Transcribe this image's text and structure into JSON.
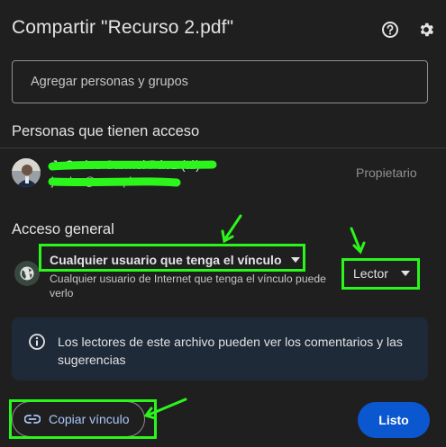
{
  "dialog": {
    "title": "Compartir \"Recurso 2.pdf\"",
    "help_icon": "help-circle-icon",
    "settings_icon": "gear-icon"
  },
  "add_people": {
    "placeholder": "Agregar personas y grupos"
  },
  "people_section": {
    "title": "Personas que tienen acceso",
    "person": {
      "name": "J. Carlos Carmel Páez (tú)",
      "email": "jcarlos@example.com",
      "role": "Propietario"
    }
  },
  "general_access": {
    "title": "Acceso general",
    "icon": "globe-icon",
    "selected": "Cualquier usuario que tenga el vínculo",
    "description": "Cualquier usuario de Internet que tenga el vínculo puede verlo",
    "role": "Lector"
  },
  "info": {
    "icon": "info-icon",
    "text": "Los lectores de este archivo pueden ver los comentarios y las sugerencias"
  },
  "buttons": {
    "copy_link": "Copiar vínculo",
    "copy_icon": "link-icon",
    "done": "Listo"
  },
  "colors": {
    "background": "#1f1f1f",
    "accent_blue": "#0b57d0",
    "link_blue": "#a8c7fa",
    "annotation_green": "#2bf51b",
    "info_bg": "#1e2a38"
  }
}
